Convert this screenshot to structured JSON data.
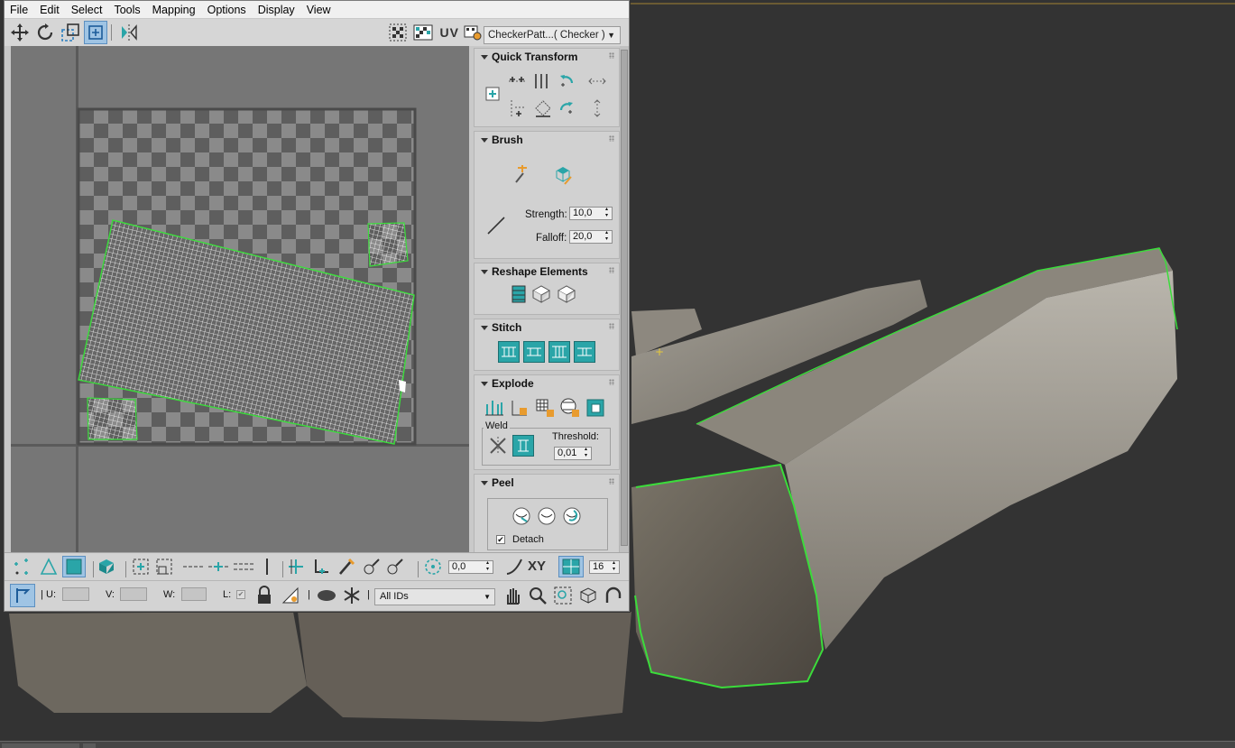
{
  "menu": [
    "File",
    "Edit",
    "Select",
    "Tools",
    "Mapping",
    "Options",
    "Display",
    "View"
  ],
  "toolbar": {
    "uv_label": "UV",
    "map_select": "CheckerPatt...( Checker )",
    "icons": [
      "move-icon",
      "rotate-icon",
      "scale-icon",
      "freeform-icon",
      "mirror-icon",
      "checker-icon",
      "texture-display-icon",
      "uv-channel-icon",
      "map-settings-icon"
    ]
  },
  "rollouts": {
    "quick_transform": {
      "title": "Quick Transform"
    },
    "brush": {
      "title": "Brush",
      "strength_label": "Strength:",
      "strength_value": "10,0",
      "falloff_label": "Falloff:",
      "falloff_value": "20,0"
    },
    "reshape": {
      "title": "Reshape Elements"
    },
    "stitch": {
      "title": "Stitch"
    },
    "explode": {
      "title": "Explode",
      "weld_label": "Weld",
      "threshold_label": "Threshold:",
      "threshold_value": "0,01"
    },
    "peel": {
      "title": "Peel",
      "detach_label": "Detach",
      "detach_checked": true
    }
  },
  "bottom": {
    "angle_value": "0,0",
    "xy_label": "XY",
    "grid_value": "16",
    "u_label": "U:",
    "v_label": "V:",
    "w_label": "W:",
    "l_label": "L:",
    "id_select": "All IDs"
  },
  "colors": {
    "selection_green": "#3bdc3b",
    "accent_teal": "#2aa5a8",
    "checker_dark": "#5e5e5e",
    "checker_light": "#8a8a8a"
  }
}
